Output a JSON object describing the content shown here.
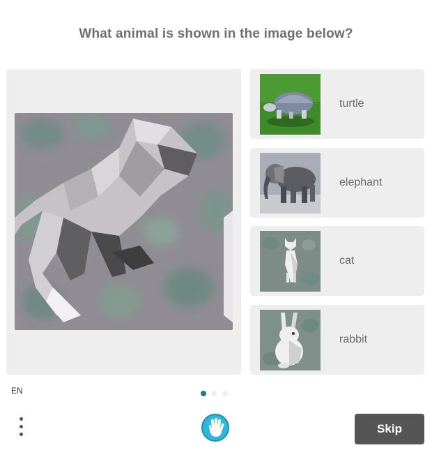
{
  "prompt": "What animal is shown in the image below?",
  "main_image": {
    "subject": "low-poly animal on mottled background"
  },
  "options": [
    {
      "label": "turtle"
    },
    {
      "label": "elephant"
    },
    {
      "label": "cat"
    },
    {
      "label": "rabbit"
    }
  ],
  "footer": {
    "language": "EN",
    "page_indicator": {
      "total": 3,
      "active": 1
    },
    "menu_icon": "vertical-ellipsis-icon",
    "logo_icon": "hand-logo-icon",
    "skip_label": "Skip"
  },
  "colors": {
    "panel_bg": "#eeeeee",
    "prompt_text": "#6e6e6e",
    "option_text": "#6a6a6a",
    "active_dot": "#1e7c8c",
    "skip_bg": "#555555",
    "logo_accent": "#2fb8d8"
  }
}
